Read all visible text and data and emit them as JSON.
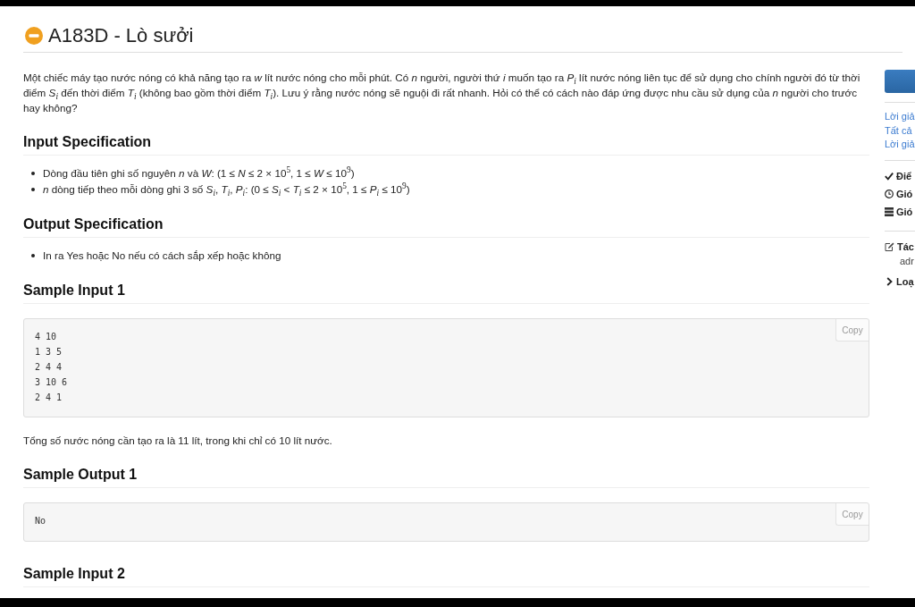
{
  "problem": {
    "title": "A183D - Lò sưởi",
    "statement": "Một chiếc máy tạo nước nóng có khả năng tạo ra *w* lít nước nóng cho mỗi phút. Có *n* người, người thứ *i* muốn tạo ra *P*$_{i}$ lít nước nóng liên tục để sử dụng cho chính người đó từ thời điểm *S*$_{i}$ đến thời điểm *T*$_{i}$ (không bao gồm thời điểm *T*$_{i}$). Lưu ý rằng nước nóng sẽ nguội đi rất nhanh. Hỏi có thể có cách nào đáp ứng được nhu cầu sử dụng của *n* người cho trước hay không?",
    "sections": [
      {
        "kind": "list",
        "heading": "Input Specification",
        "items": [
          "Dòng đầu tiên ghi số nguyên *n* và *W*: (1 ≤ *N* ≤ 2 × 10$^{5}$, 1 ≤ *W* ≤ 10$^{9}$)",
          "*n* dòng tiếp theo mỗi dòng ghi 3 số *S*$_{i}$, *T*$_{i}$, *P*$_{i}$: (0 ≤ *S*$_{i}$ < *T*$_{i}$ ≤ 2 × 10$^{5}$, 1 ≤ *P*$_{i}$ ≤ 10$^{9}$)"
        ]
      },
      {
        "kind": "list",
        "heading": "Output Specification",
        "items": [
          "In ra Yes hoặc No nếu có cách sắp xếp hoặc không"
        ]
      },
      {
        "kind": "sample",
        "heading": "Sample Input 1",
        "lines": [
          "4 10",
          "1 3 5",
          "2 4 4",
          "3 10 6",
          "2 4 1"
        ],
        "copy_label": "Copy",
        "note": "Tổng số nước nóng cần tạo ra là 11 lít, trong khi chỉ có 10 lít nước."
      },
      {
        "kind": "sample",
        "heading": "Sample Output 1",
        "lines": [
          "No"
        ],
        "copy_label": "Copy"
      },
      {
        "kind": "heading",
        "heading": "Sample Input 2"
      }
    ]
  },
  "sidebar": {
    "links": [
      "Lời giả",
      "Tất cả",
      "Lời giả"
    ],
    "info": [
      "Điể",
      "Gió",
      "Gió"
    ],
    "author": {
      "label": "Tác",
      "value": "adr"
    },
    "types": {
      "label": "Loạ"
    }
  }
}
